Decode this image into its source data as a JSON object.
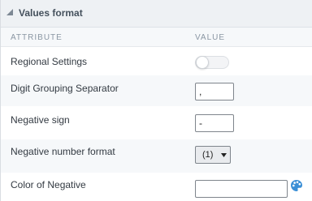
{
  "panel": {
    "title": "Values format",
    "collapse_icon": "collapse-triangle-icon"
  },
  "columns": {
    "attribute": "ATTRIBUTE",
    "value": "VALUE"
  },
  "rows": {
    "regional_settings": {
      "label": "Regional Settings",
      "enabled": false
    },
    "digit_grouping": {
      "label": "Digit Grouping Separator",
      "value": ","
    },
    "negative_sign": {
      "label": "Negative sign",
      "value": "-"
    },
    "negative_number_format": {
      "label": "Negative number format",
      "selected": "(1)"
    },
    "color_of_negative": {
      "label": "Color of Negative",
      "value": "",
      "icon": "color-palette-icon"
    }
  },
  "colors": {
    "palette_accent": "#3b8fd6"
  }
}
